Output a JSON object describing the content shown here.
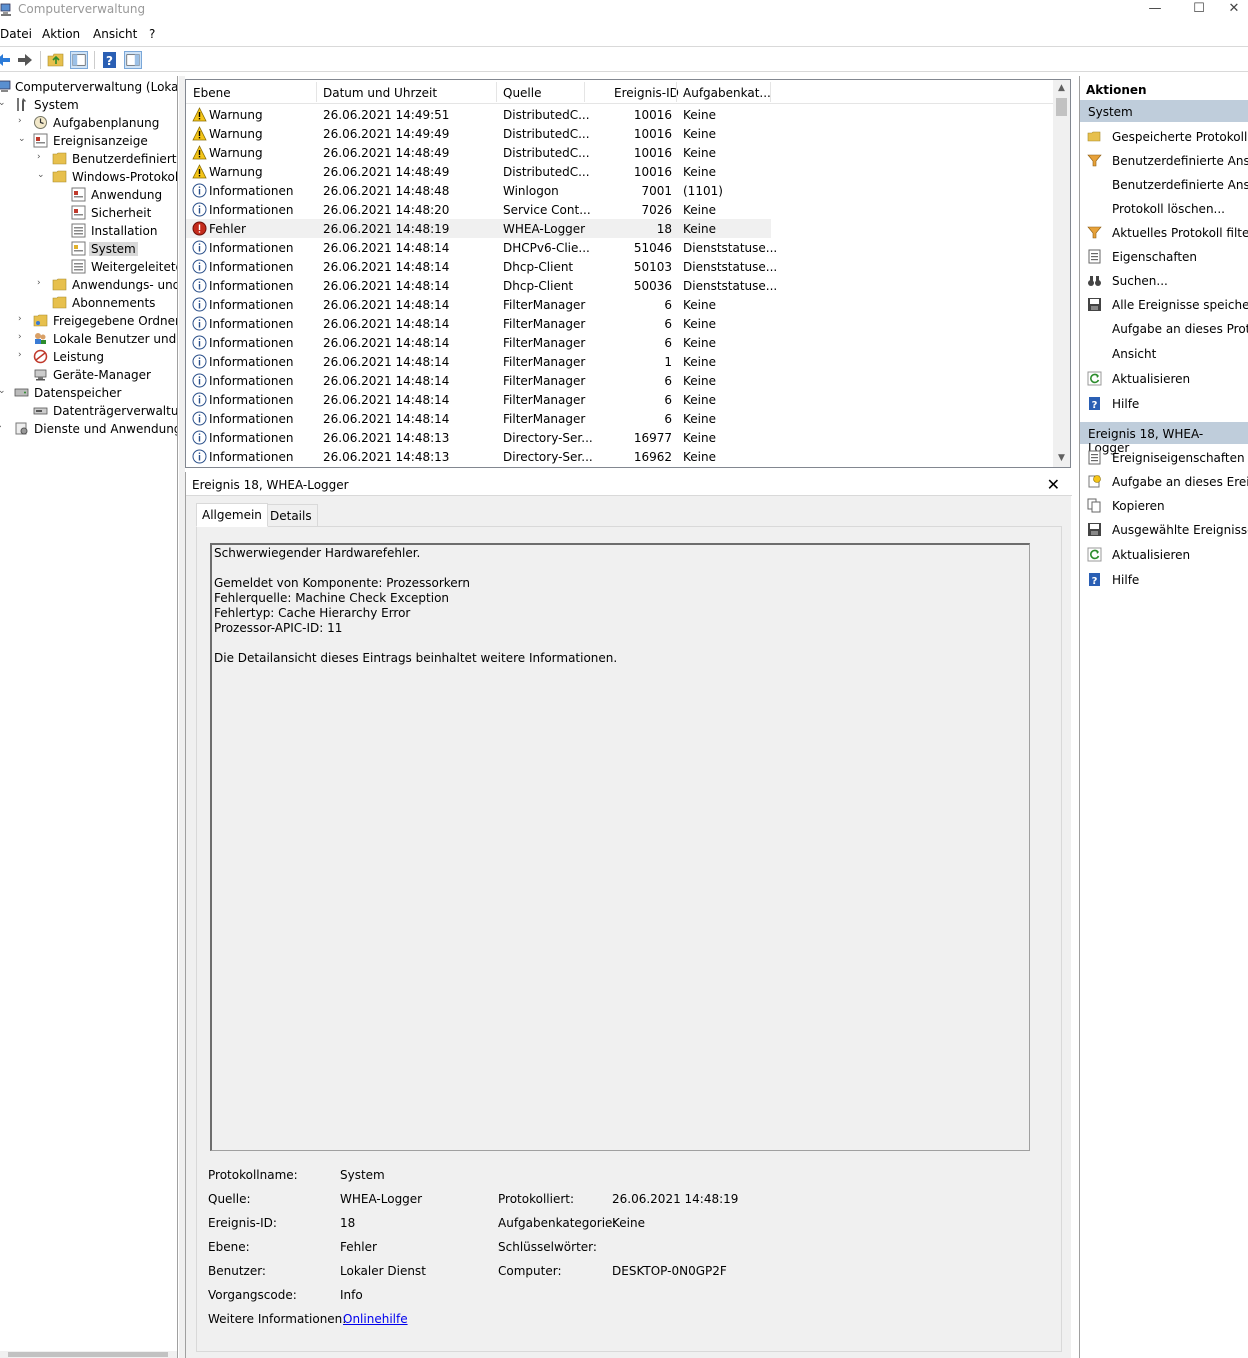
{
  "window": {
    "title": "Computerverwaltung",
    "minimize": "—",
    "maximize": "☐",
    "close": "✕"
  },
  "menu": {
    "file": "Datei",
    "action": "Aktion",
    "view": "Ansicht",
    "help": "?"
  },
  "tree": {
    "root": "Computerverwaltung (Lokal)",
    "system": "System",
    "task_scheduler": "Aufgabenplanung",
    "event_viewer": "Ereignisanzeige",
    "custom_views": "Benutzerdefinierte A",
    "windows_logs": "Windows-Protokolle",
    "application": "Anwendung",
    "security": "Sicherheit",
    "setup": "Installation",
    "system_log": "System",
    "forwarded": "Weitergeleitete E",
    "app_services": "Anwendungs- und D",
    "subscriptions": "Abonnements",
    "shared_folders": "Freigegebene Ordner",
    "local_users": "Lokale Benutzer und Gr",
    "performance": "Leistung",
    "device_manager": "Geräte-Manager",
    "storage": "Datenspeicher",
    "disk_mgmt": "Datenträgerverwaltung",
    "services_apps": "Dienste und Anwendungen"
  },
  "columns": {
    "level": "Ebene",
    "datetime": "Datum und Uhrzeit",
    "source": "Quelle",
    "event_id": "Ereignis-ID",
    "task": "Aufgabenkat..."
  },
  "events": [
    {
      "level": "Warnung",
      "type": "warning",
      "datetime": "26.06.2021 14:49:51",
      "source": "DistributedC...",
      "id": "10016",
      "task": "Keine"
    },
    {
      "level": "Warnung",
      "type": "warning",
      "datetime": "26.06.2021 14:49:49",
      "source": "DistributedC...",
      "id": "10016",
      "task": "Keine"
    },
    {
      "level": "Warnung",
      "type": "warning",
      "datetime": "26.06.2021 14:48:49",
      "source": "DistributedC...",
      "id": "10016",
      "task": "Keine"
    },
    {
      "level": "Warnung",
      "type": "warning",
      "datetime": "26.06.2021 14:48:49",
      "source": "DistributedC...",
      "id": "10016",
      "task": "Keine"
    },
    {
      "level": "Informationen",
      "type": "info",
      "datetime": "26.06.2021 14:48:48",
      "source": "Winlogon",
      "id": "7001",
      "task": "(1101)"
    },
    {
      "level": "Informationen",
      "type": "info",
      "datetime": "26.06.2021 14:48:20",
      "source": "Service Cont...",
      "id": "7026",
      "task": "Keine"
    },
    {
      "level": "Fehler",
      "type": "error",
      "datetime": "26.06.2021 14:48:19",
      "source": "WHEA-Logger",
      "id": "18",
      "task": "Keine"
    },
    {
      "level": "Informationen",
      "type": "info",
      "datetime": "26.06.2021 14:48:14",
      "source": "DHCPv6-Clie...",
      "id": "51046",
      "task": "Dienststatuse..."
    },
    {
      "level": "Informationen",
      "type": "info",
      "datetime": "26.06.2021 14:48:14",
      "source": "Dhcp-Client",
      "id": "50103",
      "task": "Dienststatuse..."
    },
    {
      "level": "Informationen",
      "type": "info",
      "datetime": "26.06.2021 14:48:14",
      "source": "Dhcp-Client",
      "id": "50036",
      "task": "Dienststatuse..."
    },
    {
      "level": "Informationen",
      "type": "info",
      "datetime": "26.06.2021 14:48:14",
      "source": "FilterManager",
      "id": "6",
      "task": "Keine"
    },
    {
      "level": "Informationen",
      "type": "info",
      "datetime": "26.06.2021 14:48:14",
      "source": "FilterManager",
      "id": "6",
      "task": "Keine"
    },
    {
      "level": "Informationen",
      "type": "info",
      "datetime": "26.06.2021 14:48:14",
      "source": "FilterManager",
      "id": "6",
      "task": "Keine"
    },
    {
      "level": "Informationen",
      "type": "info",
      "datetime": "26.06.2021 14:48:14",
      "source": "FilterManager",
      "id": "1",
      "task": "Keine"
    },
    {
      "level": "Informationen",
      "type": "info",
      "datetime": "26.06.2021 14:48:14",
      "source": "FilterManager",
      "id": "6",
      "task": "Keine"
    },
    {
      "level": "Informationen",
      "type": "info",
      "datetime": "26.06.2021 14:48:14",
      "source": "FilterManager",
      "id": "6",
      "task": "Keine"
    },
    {
      "level": "Informationen",
      "type": "info",
      "datetime": "26.06.2021 14:48:14",
      "source": "FilterManager",
      "id": "6",
      "task": "Keine"
    },
    {
      "level": "Informationen",
      "type": "info",
      "datetime": "26.06.2021 14:48:13",
      "source": "Directory-Ser...",
      "id": "16977",
      "task": "Keine"
    },
    {
      "level": "Informationen",
      "type": "info",
      "datetime": "26.06.2021 14:48:13",
      "source": "Directory-Ser...",
      "id": "16962",
      "task": "Keine"
    }
  ],
  "detail": {
    "title": "Ereignis 18, WHEA-Logger",
    "close": "✕",
    "tab_general": "Allgemein",
    "tab_details": "Details",
    "description": [
      "Schwerwiegender Hardwarefehler.",
      "",
      "Gemeldet von Komponente: Prozessorkern",
      "Fehlerquelle: Machine Check Exception",
      "Fehlertyp: Cache Hierarchy Error",
      "Prozessor-APIC-ID: 11",
      "",
      "Die Detailansicht dieses Eintrags beinhaltet weitere Informationen."
    ],
    "labels": {
      "log_name": "Protokollname:",
      "source": "Quelle:",
      "event_id": "Ereignis-ID:",
      "level": "Ebene:",
      "user": "Benutzer:",
      "opcode": "Vorgangscode:",
      "more_info": "Weitere Informationen:",
      "logged": "Protokolliert:",
      "task_category": "Aufgabenkategorie:",
      "keywords": "Schlüsselwörter:",
      "computer": "Computer:"
    },
    "values": {
      "log_name": "System",
      "source": "WHEA-Logger",
      "event_id": "18",
      "level": "Fehler",
      "user": "Lokaler Dienst",
      "opcode": "Info",
      "more_info": "Onlinehilfe",
      "logged": "26.06.2021 14:48:19",
      "task_category": "Keine",
      "keywords": "",
      "computer": "DESKTOP-0N0GP2F"
    }
  },
  "actions": {
    "header": "Aktionen",
    "section_system": "System",
    "system_items": [
      "Gespeicherte Protokoll...",
      "Benutzerdefinierte Ansi...",
      "Benutzerdefinierte Ansi...",
      "Protokoll löschen...",
      "Aktuelles Protokoll filte...",
      "Eigenschaften",
      "Suchen...",
      "Alle Ereignisse speicher...",
      "Aufgabe an dieses Prot...",
      "Ansicht",
      "Aktualisieren",
      "Hilfe"
    ],
    "section_event": "Ereignis 18, WHEA-Logger",
    "event_items": [
      "Ereigniseigenschaften",
      "Aufgabe an dieses Erei...",
      "Kopieren",
      "Ausgewählte Ereignisse...",
      "Aktualisieren",
      "Hilfe"
    ]
  }
}
